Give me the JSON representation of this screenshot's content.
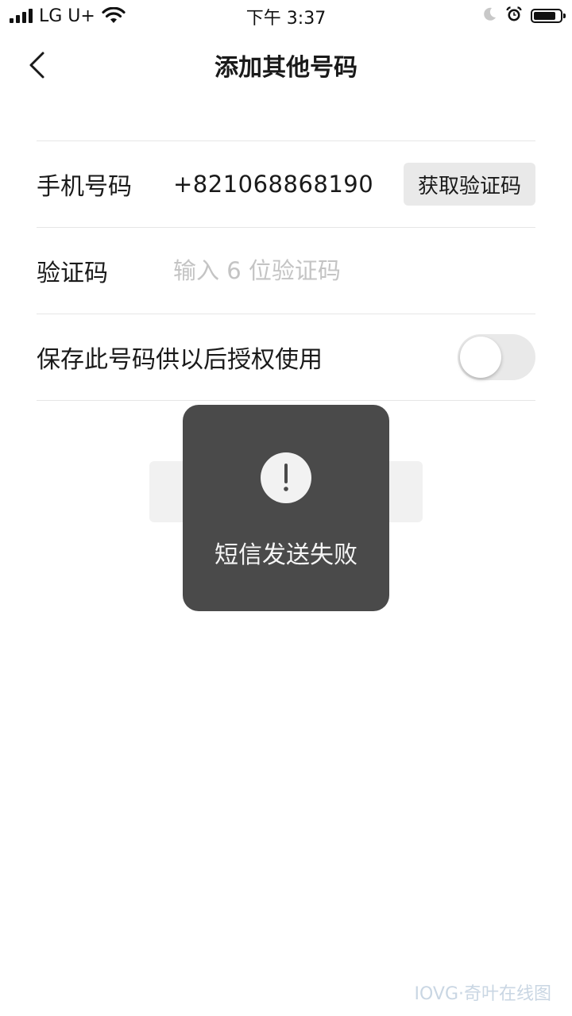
{
  "status_bar": {
    "carrier": "LG U+",
    "time": "下午 3:37",
    "battery_level": 0.85
  },
  "nav": {
    "title": "添加其他号码"
  },
  "form": {
    "phone_label": "手机号码",
    "phone_value": "+821068868190",
    "get_code_label": "获取验证码",
    "code_label": "验证码",
    "code_placeholder": "输入 6 位验证码",
    "code_value": "",
    "save_label": "保存此号码供以后授权使用",
    "save_enabled": false
  },
  "toast": {
    "message": "短信发送失败"
  },
  "watermark": {
    "text": "IOVG·奇叶在线图"
  }
}
